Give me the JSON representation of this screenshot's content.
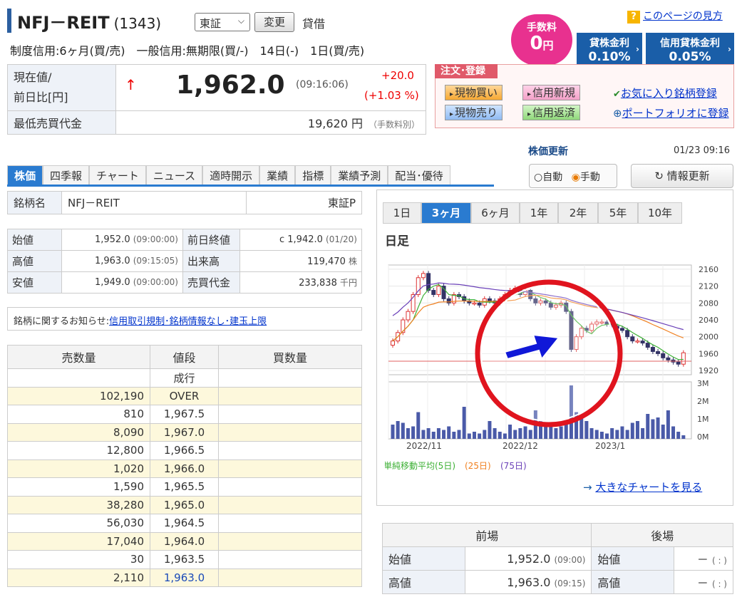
{
  "header": {
    "name": "NFJ－REIT",
    "code": "(1343)",
    "market": "東証",
    "change_btn": "変更",
    "taishaku": "貸借",
    "seido": "制度信用:6ヶ月(買/売)　一般信用:無期限(買/-)　14日(-)　1日(買/売)",
    "help": "このページの見方"
  },
  "fee": {
    "label": "手数料",
    "value": "0",
    "unit": "円"
  },
  "kashikabu": {
    "label": "貸株金利",
    "value": "0.10%"
  },
  "shinyo": {
    "label": "信用貸株金利",
    "value": "0.05%"
  },
  "price": {
    "label1": "現在値/",
    "label2": "前日比[円]",
    "arrow": "↑",
    "value": "1,962.0",
    "time": "(09:16:06)",
    "diff": "+20.0",
    "pct": "(+1.03 %)",
    "min_label": "最低売買代金",
    "min_value": "19,620 円",
    "min_note": "（手数料別）"
  },
  "order": {
    "tab": "注文･登録",
    "buy": "現物買い",
    "margin_new": "信用新規",
    "sell": "現物売り",
    "margin_repay": "信用返済",
    "fav": "お気に入り銘柄登録",
    "portfolio": "ポートフォリオに登録"
  },
  "update": {
    "label": "株価更新",
    "time": "01/23 09:16",
    "auto": "自動",
    "manual": "手動",
    "refresh": "情報更新"
  },
  "tabs": [
    "株価",
    "四季報",
    "チャート",
    "ニュース",
    "適時開示",
    "業績",
    "指標",
    "業績予測",
    "配当･優待"
  ],
  "meigara": {
    "label": "銘柄名",
    "name": "NFJ－REIT",
    "market": "東証P"
  },
  "ohlc": [
    {
      "l": "始値",
      "v": "1,952.0",
      "t": "(09:00:00)",
      "l2": "前日終値",
      "v2": "c 1,942.0",
      "t2": "(01/20)"
    },
    {
      "l": "高値",
      "v": "1,963.0",
      "t": "(09:15:05)",
      "l2": "出来高",
      "v2": "119,470",
      "t2": "株"
    },
    {
      "l": "安値",
      "v": "1,949.0",
      "t": "(09:00:00)",
      "l2": "売買代金",
      "v2": "233,838",
      "t2": "千円"
    }
  ],
  "notice": {
    "label": "銘柄に関するお知らせ:",
    "link": "信用取引規制･銘柄情報なし･建玉上限"
  },
  "book": {
    "h1": "売数量",
    "h2": "値段",
    "h3": "買数量",
    "rows": [
      [
        "",
        "成行",
        ""
      ],
      [
        "102,190",
        "OVER",
        ""
      ],
      [
        "810",
        "1,967.5",
        ""
      ],
      [
        "8,090",
        "1,967.0",
        ""
      ],
      [
        "12,800",
        "1,966.5",
        ""
      ],
      [
        "1,020",
        "1,966.0",
        ""
      ],
      [
        "1,590",
        "1,965.5",
        ""
      ],
      [
        "38,280",
        "1,965.0",
        ""
      ],
      [
        "56,030",
        "1,964.5",
        ""
      ],
      [
        "17,040",
        "1,964.0",
        ""
      ],
      [
        "30",
        "1,963.5",
        ""
      ],
      [
        "2,110",
        "1,963.0",
        ""
      ]
    ]
  },
  "period_tabs": [
    "1日",
    "3ヶ月",
    "6ヶ月",
    "1年",
    "2年",
    "5年",
    "10年"
  ],
  "chart_title": "日足",
  "chart_data": {
    "type": "candlestick",
    "x_ticks": [
      "2022/11",
      "2022/12",
      "2023/1"
    ],
    "y_ticks": [
      2160,
      2120,
      2080,
      2040,
      2000,
      1960,
      1920
    ],
    "ylim": [
      1910,
      2170
    ],
    "vol_ticks": [
      "3M",
      "2M",
      "1M",
      "0M"
    ],
    "close": [
      1990,
      2010,
      2040,
      2060,
      2100,
      2140,
      2150,
      2110,
      2100,
      2120,
      2090,
      2080,
      2100,
      2095,
      2085,
      2080,
      2080,
      2075,
      2090,
      2085,
      2080,
      2090,
      2100,
      2110,
      2115,
      2100,
      2110,
      2090,
      2080,
      2085,
      2080,
      2070,
      2075,
      2080,
      2060,
      1970,
      2000,
      2020,
      2015,
      2030,
      2035,
      2035,
      2030,
      2025,
      2020,
      2015,
      2000,
      1990,
      1990,
      1985,
      1975,
      1965,
      1960,
      1950,
      1945,
      1940,
      1935,
      1962
    ],
    "volume": [
      0.8,
      1.0,
      0.9,
      0.6,
      0.7,
      1.5,
      0.5,
      0.6,
      0.4,
      0.6,
      0.5,
      0.7,
      0.4,
      0.5,
      1.8,
      0.3,
      0.4,
      0.3,
      0.5,
      1.0,
      0.6,
      0.4,
      0.3,
      0.8,
      0.5,
      0.6,
      0.7,
      0.5,
      1.6,
      1.0,
      0.9,
      0.8,
      0.6,
      0.7,
      0.9,
      3.0,
      1.5,
      1.2,
      1.0,
      0.6,
      0.5,
      0.4,
      0.3,
      0.6,
      0.5,
      0.7,
      0.5,
      0.9,
      1.0,
      0.6,
      1.4,
      1.1,
      1.2,
      0.8,
      1.6,
      0.7,
      0.4,
      0.2
    ],
    "legend": {
      "prefix": "単純移動平均",
      "ma5": "(5日)",
      "ma25": "(25日)",
      "ma75": "(75日)"
    }
  },
  "big_chart": "大きなチャートを見る",
  "session": {
    "zenba": "前場",
    "goba": "後場",
    "rows": [
      {
        "l": "始値",
        "v": "1,952.0",
        "t": "(09:00)",
        "l2": "始値",
        "v2": "－",
        "t2": "( : )"
      },
      {
        "l": "高値",
        "v": "1,963.0",
        "t": "(09:15)",
        "l2": "高値",
        "v2": "－",
        "t2": "( : )"
      }
    ]
  }
}
